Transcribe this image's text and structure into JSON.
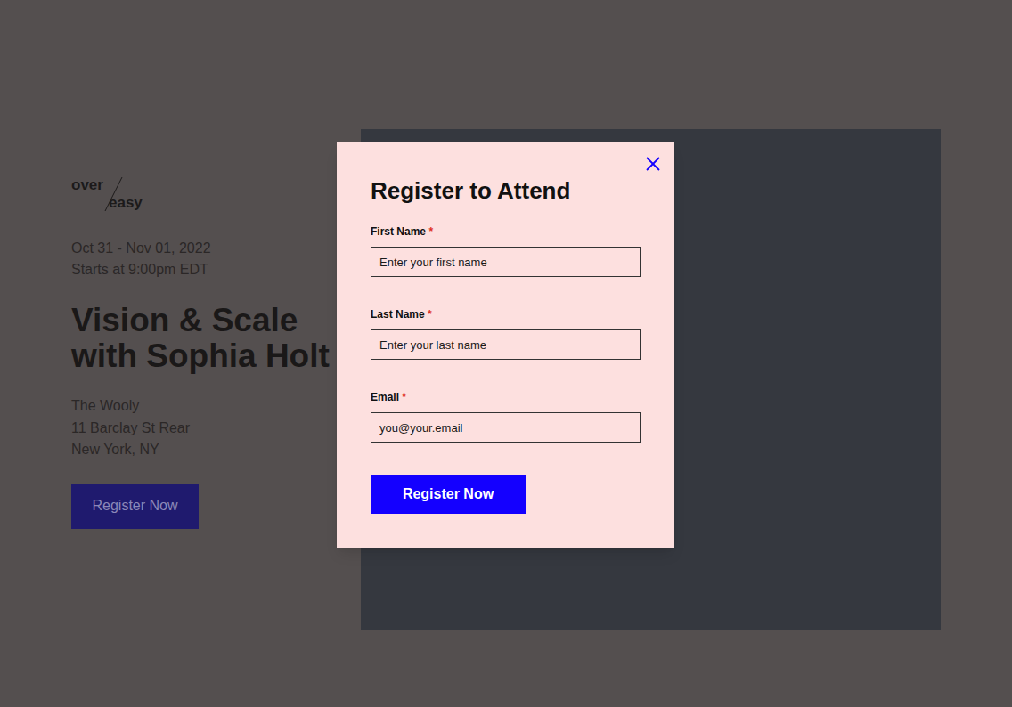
{
  "event": {
    "logo": [
      "over",
      "easy"
    ],
    "dates": [
      "Oct 31 - Nov 01, 2022",
      "Starts at 9:00pm EDT"
    ],
    "title": [
      "Vision & Scale",
      "with Sophia Holt"
    ],
    "venue": [
      "The Wooly",
      "11 Barclay St Rear",
      "New York, NY"
    ],
    "register_button": "Register Now"
  },
  "modal": {
    "title": "Register to Attend",
    "fields": [
      {
        "label": "First Name",
        "required_mark": "*",
        "placeholder": "Enter your first name"
      },
      {
        "label": "Last Name",
        "required_mark": "*",
        "placeholder": "Enter your last name"
      },
      {
        "label": "Email",
        "required_mark": "*",
        "placeholder": "you@your.email"
      }
    ],
    "submit": "Register Now"
  }
}
